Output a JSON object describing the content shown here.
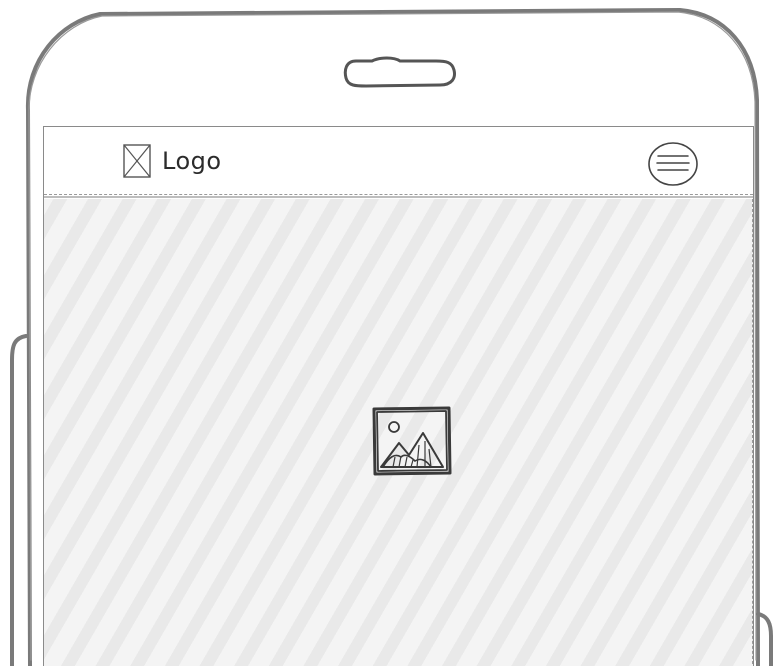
{
  "header": {
    "logo_label": "Logo"
  },
  "icons": {
    "logo_placeholder": "image-placeholder-box-icon",
    "menu": "hamburger-menu-icon",
    "hero_image": "image-icon",
    "speaker": "speaker-slot-icon"
  },
  "colors": {
    "stroke": "#6e6e6e",
    "hero_fill": "#f1f1f1",
    "hero_stripe": "#e9e9e9"
  }
}
